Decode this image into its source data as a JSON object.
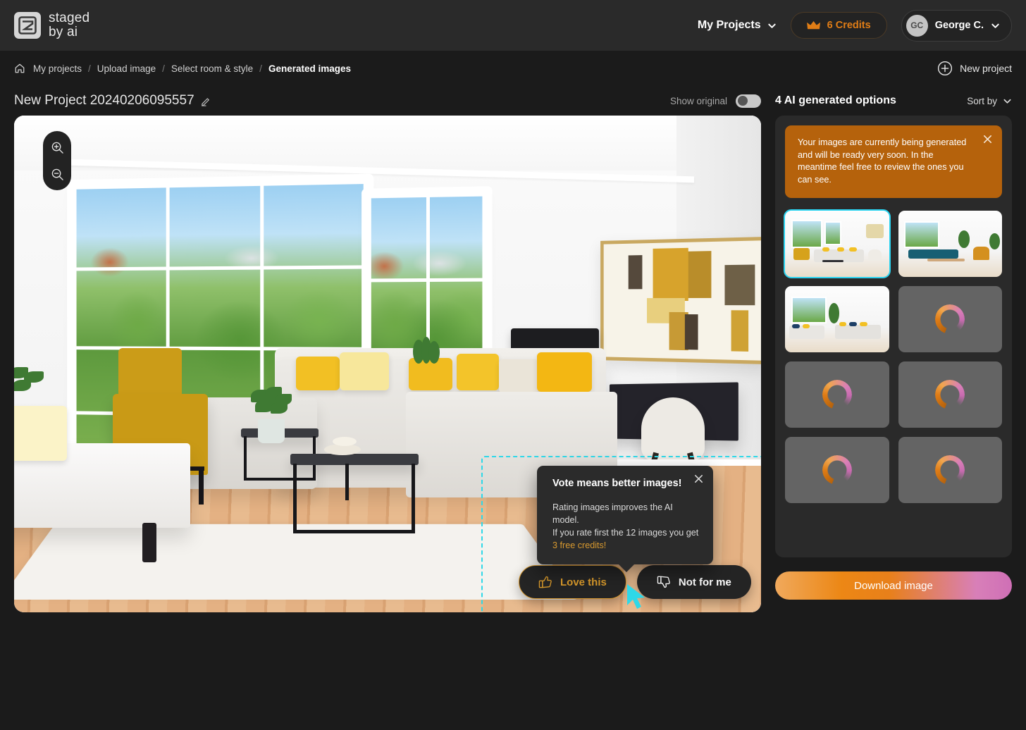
{
  "header": {
    "logo_line1": "staged",
    "logo_line2": "by ai",
    "logo_icon": "staged-by-ai-logo-icon",
    "my_projects_label": "My Projects",
    "credits_label": "6 Credits",
    "credits_icon": "crown-icon",
    "user_initials": "GC",
    "user_name": "George C.",
    "accent_orange": "#e07d16"
  },
  "breadcrumb": {
    "home_icon": "home-icon",
    "items": [
      {
        "label": "My projects",
        "active": false
      },
      {
        "label": "Upload image",
        "active": false
      },
      {
        "label": "Select room & style",
        "active": false
      },
      {
        "label": "Generated images",
        "active": true
      }
    ],
    "separator": "/",
    "new_project_label": "New project",
    "new_project_icon": "plus-circle-icon"
  },
  "project": {
    "title": "New Project 20240206095557",
    "edit_icon": "pencil-icon",
    "show_original_label": "Show original",
    "show_original_on": false
  },
  "viewer": {
    "zoom_in_icon": "zoom-in-icon",
    "zoom_out_icon": "zoom-out-icon",
    "highlight_color": "#2ed8e8",
    "cursor_icon": "mouse-cursor-icon"
  },
  "tooltip": {
    "title": "Vote means better images!",
    "line1": "Rating images improves the AI model.",
    "line2": "If you rate first the 12 images you get",
    "credit_line": "3 free credits!",
    "close_icon": "close-icon"
  },
  "vote": {
    "love_label": "Love this",
    "love_icon": "thumbs-up-icon",
    "not_label": "Not for me",
    "not_icon": "thumbs-down-icon",
    "love_color": "#d99a2b"
  },
  "results": {
    "heading": "4 AI generated options",
    "sort_label": "Sort by",
    "sort_icon": "chevron-down-icon",
    "notice": {
      "text": "Your images are currently being generated and will be ready very soon. In the meantime feel free to review the ones you can see.",
      "close_icon": "close-icon",
      "background": "#b5620c"
    },
    "thumbnails": [
      {
        "state": "ready",
        "selected": true,
        "alt": "Living room with white sectional sofa, yellow pillows and black coffee tables"
      },
      {
        "state": "ready",
        "selected": false,
        "alt": "Living room with teal sofa, wooden coffee table and mustard armchair"
      },
      {
        "state": "ready",
        "selected": false,
        "alt": "Living room with grey sofas, navy and yellow pillows"
      },
      {
        "state": "loading",
        "selected": false,
        "alt": ""
      },
      {
        "state": "loading",
        "selected": false,
        "alt": ""
      },
      {
        "state": "loading",
        "selected": false,
        "alt": ""
      },
      {
        "state": "loading",
        "selected": false,
        "alt": ""
      },
      {
        "state": "loading",
        "selected": false,
        "alt": ""
      }
    ],
    "download_label": "Download image"
  }
}
